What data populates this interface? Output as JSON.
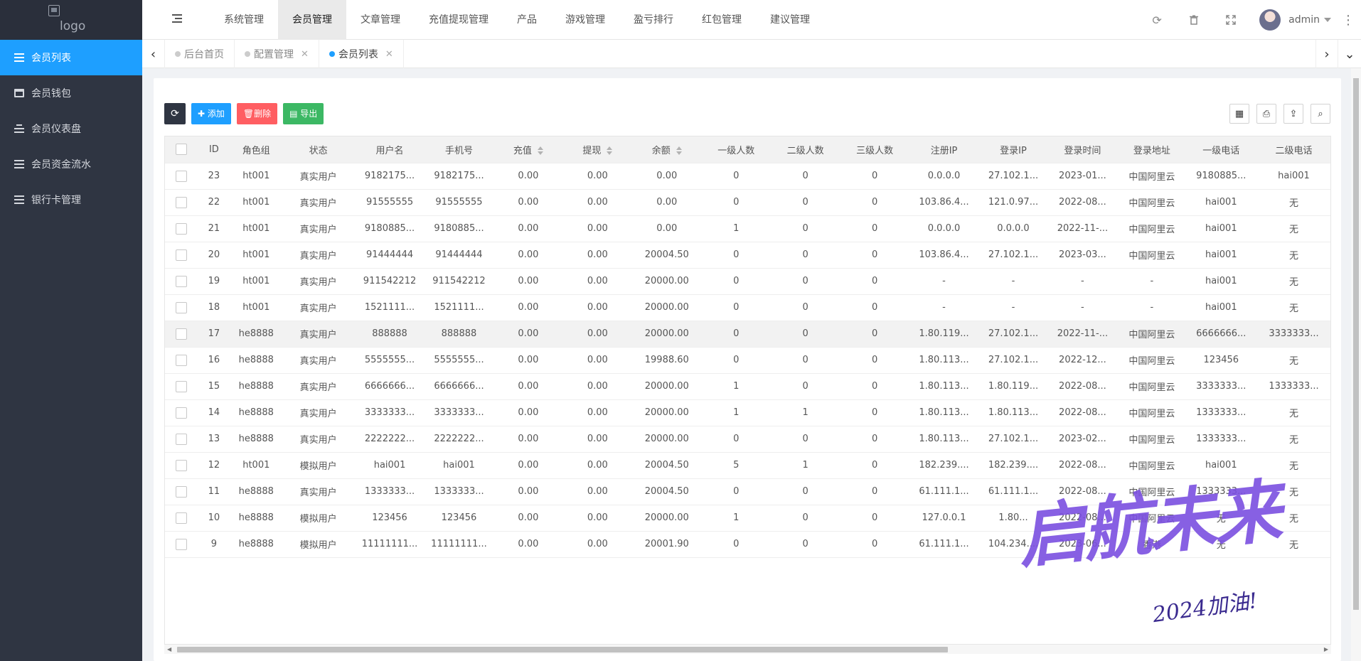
{
  "logo": {
    "alt": "logo"
  },
  "sidebar": {
    "items": [
      {
        "label": "会员列表",
        "icon": "list-icon",
        "active": true
      },
      {
        "label": "会员钱包",
        "icon": "wallet-icon",
        "active": false
      },
      {
        "label": "会员仪表盘",
        "icon": "dashboard-icon",
        "active": false
      },
      {
        "label": "会员资金流水",
        "icon": "list-icon",
        "active": false
      },
      {
        "label": "银行卡管理",
        "icon": "list-icon",
        "active": false
      }
    ]
  },
  "header": {
    "nav": [
      "系统管理",
      "会员管理",
      "文章管理",
      "充值提现管理",
      "产品",
      "游戏管理",
      "盈亏排行",
      "红包管理",
      "建议管理"
    ],
    "active_nav": "会员管理",
    "tools": [
      "refresh-icon",
      "trash-icon",
      "fullscreen-icon"
    ],
    "username": "admin"
  },
  "tabs": [
    {
      "label": "后台首页",
      "closable": false,
      "active": false
    },
    {
      "label": "配置管理",
      "closable": true,
      "active": false
    },
    {
      "label": "会员列表",
      "closable": true,
      "active": true
    }
  ],
  "toolbar": {
    "add": "添加",
    "delete": "删除",
    "export": "导出"
  },
  "table": {
    "columns": [
      "ID",
      "角色组",
      "状态",
      "用户名",
      "手机号",
      "充值",
      "提现",
      "余额",
      "一级人数",
      "二级人数",
      "三级人数",
      "注册IP",
      "登录IP",
      "登录时间",
      "登录地址",
      "一级电话",
      "二级电话"
    ],
    "sortable": [
      "充值",
      "提现",
      "余额"
    ],
    "rows": [
      [
        "23",
        "ht001",
        "真实用户",
        "9182175...",
        "9182175...",
        "0.00",
        "0.00",
        "0.00",
        "0",
        "0",
        "0",
        "0.0.0.0",
        "27.102.1...",
        "2023-01...",
        "中国阿里云",
        "9180885...",
        "hai001"
      ],
      [
        "22",
        "ht001",
        "真实用户",
        "91555555",
        "91555555",
        "0.00",
        "0.00",
        "0.00",
        "0",
        "0",
        "0",
        "103.86.4...",
        "121.0.97...",
        "2022-08...",
        "中国阿里云",
        "hai001",
        "无"
      ],
      [
        "21",
        "ht001",
        "真实用户",
        "9180885...",
        "9180885...",
        "0.00",
        "0.00",
        "0.00",
        "1",
        "0",
        "0",
        "0.0.0.0",
        "0.0.0.0",
        "2022-11-...",
        "中国阿里云",
        "hai001",
        "无"
      ],
      [
        "20",
        "ht001",
        "真实用户",
        "91444444",
        "91444444",
        "0.00",
        "0.00",
        "20004.50",
        "0",
        "0",
        "0",
        "103.86.4...",
        "27.102.1...",
        "2023-03...",
        "中国阿里云",
        "hai001",
        "无"
      ],
      [
        "19",
        "ht001",
        "真实用户",
        "911542212",
        "911542212",
        "0.00",
        "0.00",
        "20000.00",
        "0",
        "0",
        "0",
        "-",
        "-",
        "-",
        "-",
        "hai001",
        "无"
      ],
      [
        "18",
        "ht001",
        "真实用户",
        "1521111...",
        "1521111...",
        "0.00",
        "0.00",
        "20000.00",
        "0",
        "0",
        "0",
        "-",
        "-",
        "-",
        "-",
        "hai001",
        "无"
      ],
      [
        "17",
        "he8888",
        "真实用户",
        "888888",
        "888888",
        "0.00",
        "0.00",
        "20000.00",
        "0",
        "0",
        "0",
        "1.80.119...",
        "27.102.1...",
        "2022-11-...",
        "中国阿里云",
        "6666666...",
        "3333333..."
      ],
      [
        "16",
        "he8888",
        "真实用户",
        "5555555...",
        "5555555...",
        "0.00",
        "0.00",
        "19988.60",
        "0",
        "0",
        "0",
        "1.80.113...",
        "27.102.1...",
        "2022-12...",
        "中国阿里云",
        "123456",
        "无"
      ],
      [
        "15",
        "he8888",
        "真实用户",
        "6666666...",
        "6666666...",
        "0.00",
        "0.00",
        "20000.00",
        "1",
        "0",
        "0",
        "1.80.113...",
        "1.80.119...",
        "2022-08...",
        "中国阿里云",
        "3333333...",
        "1333333..."
      ],
      [
        "14",
        "he8888",
        "真实用户",
        "3333333...",
        "3333333...",
        "0.00",
        "0.00",
        "20000.00",
        "1",
        "1",
        "0",
        "1.80.113...",
        "1.80.113...",
        "2022-08...",
        "中国阿里云",
        "1333333...",
        "无"
      ],
      [
        "13",
        "he8888",
        "真实用户",
        "2222222...",
        "2222222...",
        "0.00",
        "0.00",
        "20000.00",
        "0",
        "0",
        "0",
        "1.80.113...",
        "27.102.1...",
        "2023-02...",
        "中国阿里云",
        "1333333...",
        "无"
      ],
      [
        "12",
        "ht001",
        "模拟用户",
        "hai001",
        "hai001",
        "0.00",
        "0.00",
        "20004.50",
        "5",
        "1",
        "0",
        "182.239....",
        "182.239....",
        "2022-08...",
        "中国阿里云",
        "hai001",
        "无"
      ],
      [
        "11",
        "he8888",
        "真实用户",
        "1333333...",
        "1333333...",
        "0.00",
        "0.00",
        "20004.50",
        "0",
        "0",
        "0",
        "61.111.1...",
        "61.111.1...",
        "2022-08...",
        "中国阿里云",
        "1333333...",
        "无"
      ],
      [
        "10",
        "he8888",
        "模拟用户",
        "123456",
        "123456",
        "0.00",
        "0.00",
        "20000.00",
        "1",
        "0",
        "0",
        "127.0.0.1",
        "1.80...",
        "2022-08...",
        "中国阿里云",
        "无",
        "无"
      ],
      [
        "9",
        "he8888",
        "模拟用户",
        "11111111...",
        "11111111...",
        "0.00",
        "0.00",
        "20001.90",
        "0",
        "0",
        "0",
        "61.111.1...",
        "104.234....",
        "2023-06...",
        "香港",
        "无",
        "无"
      ]
    ],
    "highlighted_row_id": "17"
  },
  "watermark": {
    "main": "启航未来",
    "sub": "2024加油!"
  },
  "colors": {
    "sidebar_bg": "#2f3542",
    "accent": "#1e9fff",
    "danger": "#ff5e62",
    "success": "#3cb864"
  }
}
